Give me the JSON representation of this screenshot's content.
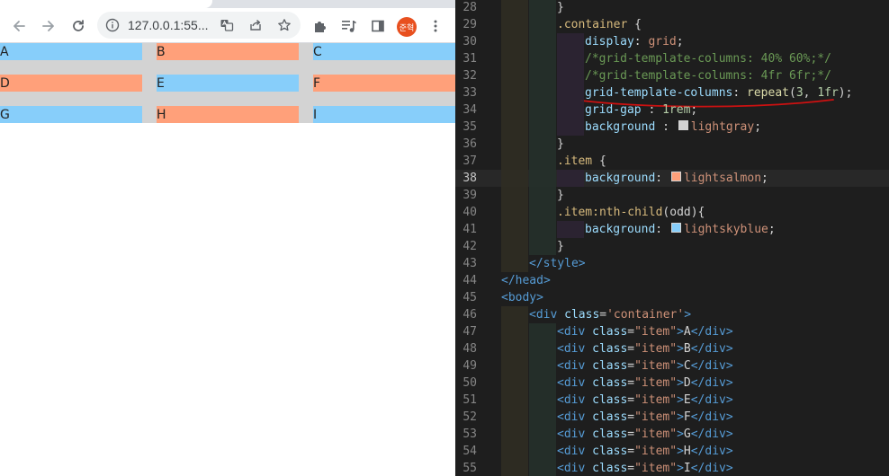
{
  "browser": {
    "url": "127.0.0.1:55...",
    "profile_label": "준혁",
    "grid_items": [
      {
        "label": "A",
        "odd": true
      },
      {
        "label": "B",
        "odd": false
      },
      {
        "label": "C",
        "odd": true
      },
      {
        "label": "D",
        "odd": false
      },
      {
        "label": "E",
        "odd": true
      },
      {
        "label": "F",
        "odd": false
      },
      {
        "label": "G",
        "odd": true
      },
      {
        "label": "H",
        "odd": false
      },
      {
        "label": "I",
        "odd": true
      }
    ],
    "colors": {
      "grid_background": "#d3d3d3",
      "item": "#ffa07a",
      "item_odd": "#87cefa"
    }
  },
  "editor": {
    "current_line": 38,
    "annotation_color": "#cc1111",
    "lines": [
      {
        "n": 28,
        "tokens": [
          {
            "t": "}",
            "c": "punc"
          }
        ]
      },
      {
        "n": 29,
        "tokens": [
          {
            "t": ".container",
            "c": "sel"
          },
          {
            "t": " {",
            "c": "punc"
          }
        ]
      },
      {
        "n": 30,
        "tokens": [
          {
            "t": "display",
            "c": "prop"
          },
          {
            "t": ": ",
            "c": "punc"
          },
          {
            "t": "grid",
            "c": "val"
          },
          {
            "t": ";",
            "c": "punc"
          }
        ]
      },
      {
        "n": 31,
        "tokens": [
          {
            "t": "/*grid-template-columns: 40% 60%;*/",
            "c": "com"
          }
        ]
      },
      {
        "n": 32,
        "tokens": [
          {
            "t": "/*grid-template-columns: 4fr 6fr;*/",
            "c": "com"
          }
        ]
      },
      {
        "n": 33,
        "tokens": [
          {
            "t": "grid-template-columns",
            "c": "prop"
          },
          {
            "t": ": ",
            "c": "punc"
          },
          {
            "t": "repeat",
            "c": "fn"
          },
          {
            "t": "(",
            "c": "punc"
          },
          {
            "t": "3",
            "c": "num"
          },
          {
            "t": ", ",
            "c": "punc"
          },
          {
            "t": "1fr",
            "c": "num"
          },
          {
            "t": ");",
            "c": "punc"
          }
        ]
      },
      {
        "n": 34,
        "tokens": [
          {
            "t": "grid-gap",
            "c": "prop"
          },
          {
            "t": " : ",
            "c": "punc"
          },
          {
            "t": "1rem",
            "c": "num"
          },
          {
            "t": ";",
            "c": "punc"
          }
        ]
      },
      {
        "n": 35,
        "tokens": [
          {
            "t": "background",
            "c": "prop"
          },
          {
            "t": " : ",
            "c": "punc"
          },
          {
            "t": "swatch",
            "c": "swatch",
            "color": "#d3d3d3"
          },
          {
            "t": "lightgray",
            "c": "val"
          },
          {
            "t": ";",
            "c": "punc"
          }
        ]
      },
      {
        "n": 36,
        "tokens": [
          {
            "t": "}",
            "c": "punc"
          }
        ]
      },
      {
        "n": 37,
        "tokens": [
          {
            "t": ".item",
            "c": "sel"
          },
          {
            "t": " {",
            "c": "punc"
          }
        ]
      },
      {
        "n": 38,
        "tokens": [
          {
            "t": "background",
            "c": "prop"
          },
          {
            "t": ": ",
            "c": "punc"
          },
          {
            "t": "swatch",
            "c": "swatch",
            "color": "#ffa07a"
          },
          {
            "t": "lightsalmon",
            "c": "val"
          },
          {
            "t": ";",
            "c": "punc"
          }
        ]
      },
      {
        "n": 39,
        "tokens": [
          {
            "t": "}",
            "c": "punc"
          }
        ]
      },
      {
        "n": 40,
        "tokens": [
          {
            "t": ".item",
            "c": "sel"
          },
          {
            "t": ":nth-child",
            "c": "sel"
          },
          {
            "t": "(odd){",
            "c": "punc"
          }
        ]
      },
      {
        "n": 41,
        "tokens": [
          {
            "t": "background",
            "c": "prop"
          },
          {
            "t": ": ",
            "c": "punc"
          },
          {
            "t": "swatch",
            "c": "swatch",
            "color": "#87cefa"
          },
          {
            "t": "lightskyblue",
            "c": "val"
          },
          {
            "t": ";",
            "c": "punc"
          }
        ]
      },
      {
        "n": 42,
        "tokens": [
          {
            "t": "}",
            "c": "punc"
          }
        ]
      },
      {
        "n": 43,
        "tokens": [
          {
            "t": "</",
            "c": "tag"
          },
          {
            "t": "style",
            "c": "tag"
          },
          {
            "t": ">",
            "c": "tag"
          }
        ]
      },
      {
        "n": 44,
        "tokens": [
          {
            "t": "</",
            "c": "tag"
          },
          {
            "t": "head",
            "c": "tag"
          },
          {
            "t": ">",
            "c": "tag"
          }
        ]
      },
      {
        "n": 45,
        "tokens": [
          {
            "t": "<",
            "c": "tag"
          },
          {
            "t": "body",
            "c": "tag"
          },
          {
            "t": ">",
            "c": "tag"
          }
        ]
      },
      {
        "n": 46,
        "tokens": [
          {
            "t": "<",
            "c": "tag"
          },
          {
            "t": "div",
            "c": "tag"
          },
          {
            "t": " class",
            "c": "attr"
          },
          {
            "t": "=",
            "c": "punc"
          },
          {
            "t": "'container'",
            "c": "str"
          },
          {
            "t": ">",
            "c": "tag"
          }
        ]
      },
      {
        "n": 47,
        "tokens": [
          {
            "t": "<",
            "c": "tag"
          },
          {
            "t": "div",
            "c": "tag"
          },
          {
            "t": " class",
            "c": "attr"
          },
          {
            "t": "=",
            "c": "punc"
          },
          {
            "t": "\"item\"",
            "c": "str"
          },
          {
            "t": ">",
            "c": "tag"
          },
          {
            "t": "A",
            "c": "txt"
          },
          {
            "t": "</",
            "c": "tag"
          },
          {
            "t": "div",
            "c": "tag"
          },
          {
            "t": ">",
            "c": "tag"
          }
        ]
      },
      {
        "n": 48,
        "tokens": [
          {
            "t": "<",
            "c": "tag"
          },
          {
            "t": "div",
            "c": "tag"
          },
          {
            "t": " class",
            "c": "attr"
          },
          {
            "t": "=",
            "c": "punc"
          },
          {
            "t": "\"item\"",
            "c": "str"
          },
          {
            "t": ">",
            "c": "tag"
          },
          {
            "t": "B",
            "c": "txt"
          },
          {
            "t": "</",
            "c": "tag"
          },
          {
            "t": "div",
            "c": "tag"
          },
          {
            "t": ">",
            "c": "tag"
          }
        ]
      },
      {
        "n": 49,
        "tokens": [
          {
            "t": "<",
            "c": "tag"
          },
          {
            "t": "div",
            "c": "tag"
          },
          {
            "t": " class",
            "c": "attr"
          },
          {
            "t": "=",
            "c": "punc"
          },
          {
            "t": "\"item\"",
            "c": "str"
          },
          {
            "t": ">",
            "c": "tag"
          },
          {
            "t": "C",
            "c": "txt"
          },
          {
            "t": "</",
            "c": "tag"
          },
          {
            "t": "div",
            "c": "tag"
          },
          {
            "t": ">",
            "c": "tag"
          }
        ]
      },
      {
        "n": 50,
        "tokens": [
          {
            "t": "<",
            "c": "tag"
          },
          {
            "t": "div",
            "c": "tag"
          },
          {
            "t": " class",
            "c": "attr"
          },
          {
            "t": "=",
            "c": "punc"
          },
          {
            "t": "\"item\"",
            "c": "str"
          },
          {
            "t": ">",
            "c": "tag"
          },
          {
            "t": "D",
            "c": "txt"
          },
          {
            "t": "</",
            "c": "tag"
          },
          {
            "t": "div",
            "c": "tag"
          },
          {
            "t": ">",
            "c": "tag"
          }
        ]
      },
      {
        "n": 51,
        "tokens": [
          {
            "t": "<",
            "c": "tag"
          },
          {
            "t": "div",
            "c": "tag"
          },
          {
            "t": " class",
            "c": "attr"
          },
          {
            "t": "=",
            "c": "punc"
          },
          {
            "t": "\"item\"",
            "c": "str"
          },
          {
            "t": ">",
            "c": "tag"
          },
          {
            "t": "E",
            "c": "txt"
          },
          {
            "t": "</",
            "c": "tag"
          },
          {
            "t": "div",
            "c": "tag"
          },
          {
            "t": ">",
            "c": "tag"
          }
        ]
      },
      {
        "n": 52,
        "tokens": [
          {
            "t": "<",
            "c": "tag"
          },
          {
            "t": "div",
            "c": "tag"
          },
          {
            "t": " class",
            "c": "attr"
          },
          {
            "t": "=",
            "c": "punc"
          },
          {
            "t": "\"item\"",
            "c": "str"
          },
          {
            "t": ">",
            "c": "tag"
          },
          {
            "t": "F",
            "c": "txt"
          },
          {
            "t": "</",
            "c": "tag"
          },
          {
            "t": "div",
            "c": "tag"
          },
          {
            "t": ">",
            "c": "tag"
          }
        ]
      },
      {
        "n": 53,
        "tokens": [
          {
            "t": "<",
            "c": "tag"
          },
          {
            "t": "div",
            "c": "tag"
          },
          {
            "t": " class",
            "c": "attr"
          },
          {
            "t": "=",
            "c": "punc"
          },
          {
            "t": "\"item\"",
            "c": "str"
          },
          {
            "t": ">",
            "c": "tag"
          },
          {
            "t": "G",
            "c": "txt"
          },
          {
            "t": "</",
            "c": "tag"
          },
          {
            "t": "div",
            "c": "tag"
          },
          {
            "t": ">",
            "c": "tag"
          }
        ]
      },
      {
        "n": 54,
        "tokens": [
          {
            "t": "<",
            "c": "tag"
          },
          {
            "t": "div",
            "c": "tag"
          },
          {
            "t": " class",
            "c": "attr"
          },
          {
            "t": "=",
            "c": "punc"
          },
          {
            "t": "\"item\"",
            "c": "str"
          },
          {
            "t": ">",
            "c": "tag"
          },
          {
            "t": "H",
            "c": "txt"
          },
          {
            "t": "</",
            "c": "tag"
          },
          {
            "t": "div",
            "c": "tag"
          },
          {
            "t": ">",
            "c": "tag"
          }
        ]
      },
      {
        "n": 55,
        "tokens": [
          {
            "t": "<",
            "c": "tag"
          },
          {
            "t": "div",
            "c": "tag"
          },
          {
            "t": " class",
            "c": "attr"
          },
          {
            "t": "=",
            "c": "punc"
          },
          {
            "t": "\"item\"",
            "c": "str"
          },
          {
            "t": ">",
            "c": "tag"
          },
          {
            "t": "I",
            "c": "txt"
          },
          {
            "t": "</",
            "c": "tag"
          },
          {
            "t": "div",
            "c": "tag"
          },
          {
            "t": ">",
            "c": "tag"
          }
        ]
      }
    ]
  }
}
